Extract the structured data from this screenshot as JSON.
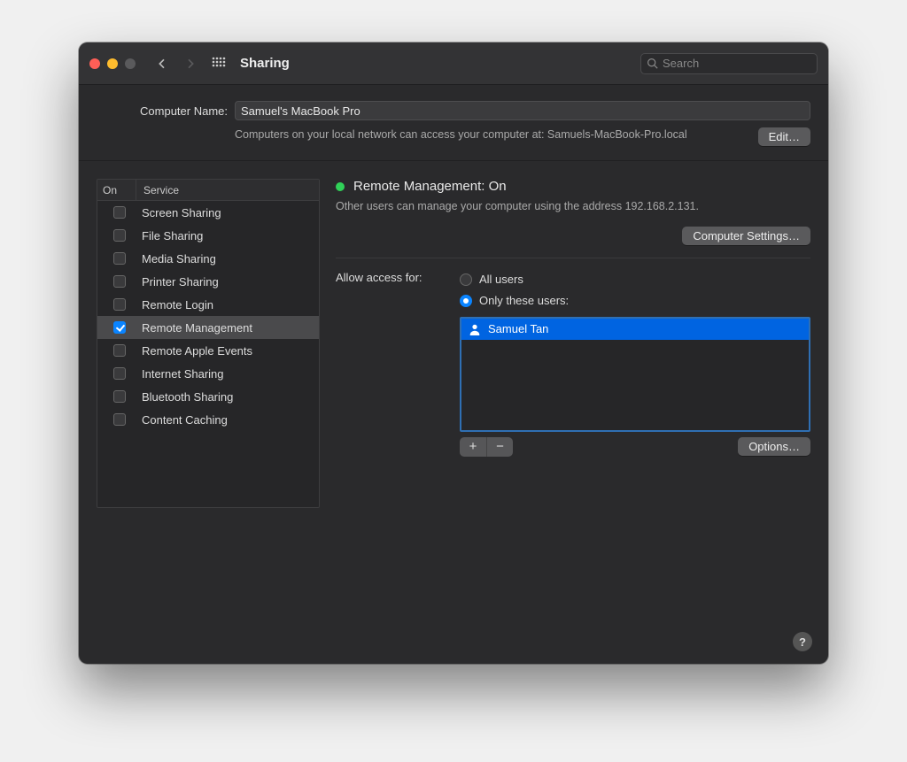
{
  "header": {
    "title": "Sharing",
    "search_placeholder": "Search"
  },
  "computer_name": {
    "label": "Computer Name:",
    "value": "Samuel's MacBook Pro",
    "subtext": "Computers on your local network can access your computer at: Samuels-MacBook-Pro.local",
    "edit_button": "Edit…"
  },
  "services": {
    "col_on": "On",
    "col_service": "Service",
    "items": [
      {
        "label": "Screen Sharing",
        "checked": false,
        "selected": false
      },
      {
        "label": "File Sharing",
        "checked": false,
        "selected": false
      },
      {
        "label": "Media Sharing",
        "checked": false,
        "selected": false
      },
      {
        "label": "Printer Sharing",
        "checked": false,
        "selected": false
      },
      {
        "label": "Remote Login",
        "checked": false,
        "selected": false
      },
      {
        "label": "Remote Management",
        "checked": true,
        "selected": true
      },
      {
        "label": "Remote Apple Events",
        "checked": false,
        "selected": false
      },
      {
        "label": "Internet Sharing",
        "checked": false,
        "selected": false
      },
      {
        "label": "Bluetooth Sharing",
        "checked": false,
        "selected": false
      },
      {
        "label": "Content Caching",
        "checked": false,
        "selected": false
      }
    ]
  },
  "detail": {
    "status_title": "Remote Management: On",
    "status_desc": "Other users can manage your computer using the address 192.168.2.131.",
    "status_color": "#30d158",
    "computer_settings_button": "Computer Settings…",
    "access_label": "Allow access for:",
    "radio_all": "All users",
    "radio_only": "Only these users:",
    "radio_selected": "only",
    "users": [
      {
        "name": "Samuel Tan"
      }
    ],
    "options_button": "Options…"
  },
  "glyphs": {
    "plus": "+",
    "minus": "−",
    "help": "?"
  }
}
